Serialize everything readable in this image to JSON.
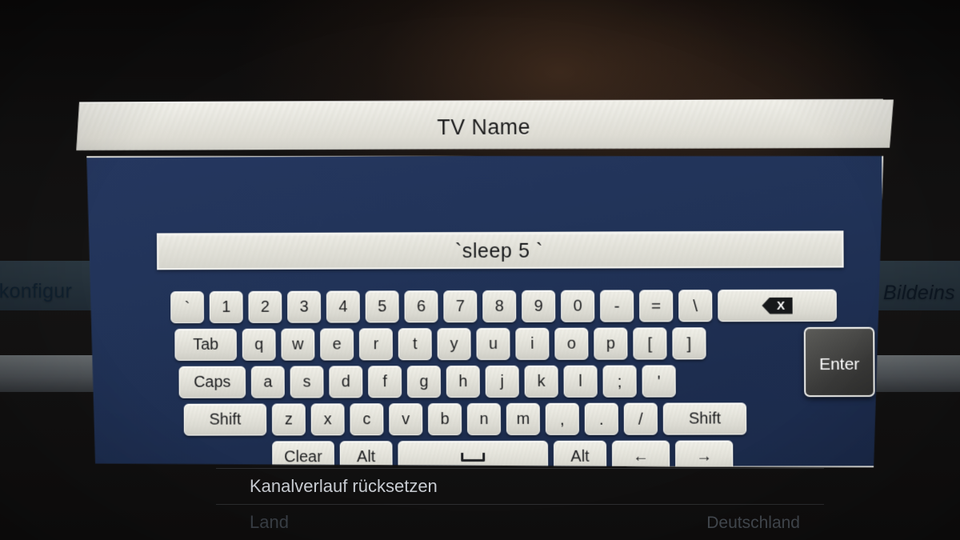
{
  "dialog": {
    "title": "TV Name",
    "input": {
      "value": "`sleep 5 `",
      "placeholder": "TV Name"
    }
  },
  "keyboard": {
    "rows": [
      {
        "id": "number-row",
        "keys": [
          {
            "label": "`",
            "name": "key-backtick"
          },
          {
            "label": "1",
            "name": "key-1"
          },
          {
            "label": "2",
            "name": "key-2"
          },
          {
            "label": "3",
            "name": "key-3"
          },
          {
            "label": "4",
            "name": "key-4"
          },
          {
            "label": "5",
            "name": "key-5"
          },
          {
            "label": "6",
            "name": "key-6"
          },
          {
            "label": "7",
            "name": "key-7"
          },
          {
            "label": "8",
            "name": "key-8"
          },
          {
            "label": "9",
            "name": "key-9"
          },
          {
            "label": "0",
            "name": "key-0"
          },
          {
            "label": "-",
            "name": "key-minus"
          },
          {
            "label": "=",
            "name": "key-equals"
          },
          {
            "label": "\\",
            "name": "key-backslash"
          },
          {
            "label": "X",
            "name": "key-backspace",
            "icon": "backspace-icon"
          }
        ]
      },
      {
        "id": "top-letter-row",
        "keys": [
          {
            "label": "Tab",
            "name": "key-tab"
          },
          {
            "label": "q",
            "name": "key-q"
          },
          {
            "label": "w",
            "name": "key-w"
          },
          {
            "label": "e",
            "name": "key-e"
          },
          {
            "label": "r",
            "name": "key-r"
          },
          {
            "label": "t",
            "name": "key-t"
          },
          {
            "label": "y",
            "name": "key-y"
          },
          {
            "label": "u",
            "name": "key-u"
          },
          {
            "label": "i",
            "name": "key-i"
          },
          {
            "label": "o",
            "name": "key-o"
          },
          {
            "label": "p",
            "name": "key-p"
          },
          {
            "label": "[",
            "name": "key-bracket-left"
          },
          {
            "label": "]",
            "name": "key-bracket-right"
          }
        ]
      },
      {
        "id": "home-letter-row",
        "keys": [
          {
            "label": "Caps",
            "name": "key-caps"
          },
          {
            "label": "a",
            "name": "key-a"
          },
          {
            "label": "s",
            "name": "key-s"
          },
          {
            "label": "d",
            "name": "key-d"
          },
          {
            "label": "f",
            "name": "key-f"
          },
          {
            "label": "g",
            "name": "key-g"
          },
          {
            "label": "h",
            "name": "key-h"
          },
          {
            "label": "j",
            "name": "key-j"
          },
          {
            "label": "k",
            "name": "key-k"
          },
          {
            "label": "l",
            "name": "key-l"
          },
          {
            "label": ";",
            "name": "key-semicolon"
          },
          {
            "label": "'",
            "name": "key-apostrophe"
          }
        ]
      },
      {
        "id": "bottom-letter-row",
        "keys": [
          {
            "label": "Shift",
            "name": "key-shift-left"
          },
          {
            "label": "z",
            "name": "key-z"
          },
          {
            "label": "x",
            "name": "key-x"
          },
          {
            "label": "c",
            "name": "key-c"
          },
          {
            "label": "v",
            "name": "key-v"
          },
          {
            "label": "b",
            "name": "key-b"
          },
          {
            "label": "n",
            "name": "key-n"
          },
          {
            "label": "m",
            "name": "key-m"
          },
          {
            "label": ",",
            "name": "key-comma"
          },
          {
            "label": ".",
            "name": "key-period"
          },
          {
            "label": "/",
            "name": "key-slash"
          },
          {
            "label": "Shift",
            "name": "key-shift-right"
          }
        ]
      },
      {
        "id": "modifier-row",
        "keys": [
          {
            "label": "Clear",
            "name": "key-clear"
          },
          {
            "label": "Alt",
            "name": "key-alt-left"
          },
          {
            "label": "",
            "name": "key-space",
            "icon": "space-icon"
          },
          {
            "label": "Alt",
            "name": "key-alt-right"
          },
          {
            "label": "←",
            "name": "key-arrow-left"
          },
          {
            "label": "→",
            "name": "key-arrow-right"
          }
        ]
      }
    ],
    "enter_key": {
      "label": "Enter",
      "selected": true
    }
  },
  "background_menu": {
    "left_partial_label": "kkonfigur",
    "right_partial_label": "Bildeins",
    "rows": [
      {
        "label": "Kanalverlauf rücksetzen",
        "value": ""
      },
      {
        "label": "Land",
        "value": "Deutschland"
      }
    ]
  },
  "colors": {
    "dialog_body": "#213357",
    "dialog_border": "#e9e9e4",
    "key_face": "#e7e6de",
    "key_text": "#1c1d1f",
    "enter_selected": "#3a3a39",
    "titlebar": "#e7e6df",
    "background": "#121111"
  }
}
